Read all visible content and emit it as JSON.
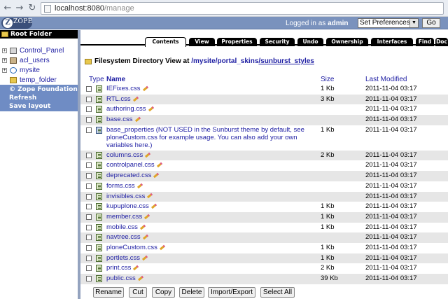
{
  "browser": {
    "url_host": "localhost:8080",
    "url_path": "/manage"
  },
  "header": {
    "logo_text": "ZOPE",
    "logged_in_prefix": "Logged in as",
    "username": "admin",
    "prefs_select_value": "Set Preferences",
    "go_label": "Go"
  },
  "tree": {
    "root_label": "Root Folder",
    "items": [
      {
        "label": "Control_Panel",
        "expandable": true,
        "icon": "control-panel-icon"
      },
      {
        "label": "acl_users",
        "expandable": true,
        "icon": "users-icon"
      },
      {
        "label": "mysite",
        "expandable": true,
        "icon": "plone-site-icon"
      },
      {
        "label": "temp_folder",
        "expandable": false,
        "icon": "temp-folder-icon"
      }
    ],
    "links": [
      "© Zope Foundation",
      "Refresh",
      "Save layout"
    ]
  },
  "tabs": [
    "Contents",
    "View",
    "Properties",
    "Security",
    "Undo",
    "Ownership",
    "Interfaces",
    "Find",
    "Doc"
  ],
  "active_tab": "Contents",
  "path": {
    "prefix": "Filesystem Directory View at",
    "segments": [
      "/mysite",
      "/portal_skins",
      "/sunburst_styles"
    ]
  },
  "columns": {
    "type": "Type",
    "name": "Name",
    "size": "Size",
    "modified": "Last Modified"
  },
  "files": [
    {
      "name": "IEFixes.css",
      "size": "1 Kb",
      "modified": "2011-11-04 03:17",
      "editable": true
    },
    {
      "name": "RTL.css",
      "size": "3 Kb",
      "modified": "2011-11-04 03:17",
      "editable": true
    },
    {
      "name": "authoring.css",
      "size": "",
      "modified": "2011-11-04 03:17",
      "editable": true
    },
    {
      "name": "base.css",
      "size": "",
      "modified": "2011-11-04 03:17",
      "editable": true
    },
    {
      "name": "base_properties (NOT USED in the Sunburst theme by default, see ploneCustom.css for example usage. You can also add your own variables here.)",
      "size": "1 Kb",
      "modified": "2011-11-04 03:17",
      "editable": false,
      "multiline": true
    },
    {
      "name": "columns.css",
      "size": "2 Kb",
      "modified": "2011-11-04 03:17",
      "editable": true
    },
    {
      "name": "controlpanel.css",
      "size": "",
      "modified": "2011-11-04 03:17",
      "editable": true
    },
    {
      "name": "deprecated.css",
      "size": "",
      "modified": "2011-11-04 03:17",
      "editable": true
    },
    {
      "name": "forms.css",
      "size": "",
      "modified": "2011-11-04 03:17",
      "editable": true
    },
    {
      "name": "invisibles.css",
      "size": "",
      "modified": "2011-11-04 03:17",
      "editable": true
    },
    {
      "name": "kupuplone.css",
      "size": "1 Kb",
      "modified": "2011-11-04 03:17",
      "editable": true
    },
    {
      "name": "member.css",
      "size": "1 Kb",
      "modified": "2011-11-04 03:17",
      "editable": true
    },
    {
      "name": "mobile.css",
      "size": "1 Kb",
      "modified": "2011-11-04 03:17",
      "editable": true
    },
    {
      "name": "navtree.css",
      "size": "",
      "modified": "2011-11-04 03:17",
      "editable": true
    },
    {
      "name": "ploneCustom.css",
      "size": "1 Kb",
      "modified": "2011-11-04 03:17",
      "editable": true
    },
    {
      "name": "portlets.css",
      "size": "1 Kb",
      "modified": "2011-11-04 03:17",
      "editable": true
    },
    {
      "name": "print.css",
      "size": "2 Kb",
      "modified": "2011-11-04 03:17",
      "editable": true
    },
    {
      "name": "public.css",
      "size": "39 Kb",
      "modified": "2011-11-04 03:17",
      "editable": true
    }
  ],
  "actions": [
    "Rename",
    "Cut",
    "Copy",
    "Delete",
    "Import/Export",
    "Select All"
  ],
  "colors": {
    "header_bg": "#7a92bd",
    "link": "#1e1ea3",
    "tree_links_bg": "#6f8cc4"
  }
}
